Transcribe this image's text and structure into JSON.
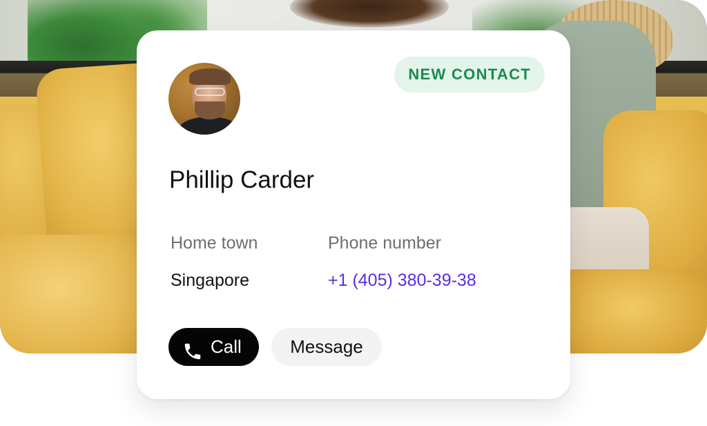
{
  "card": {
    "badge": "NEW CONTACT",
    "name": "Phillip Carder",
    "fields": [
      {
        "label": "Home town",
        "value": "Singapore"
      },
      {
        "label": "Phone number",
        "value": "+1 (405) 380-39-38"
      }
    ],
    "actions": {
      "call_label": "Call",
      "call_icon": "phone-icon",
      "message_label": "Message"
    }
  },
  "colors": {
    "badge_bg": "#e3f4ea",
    "badge_text": "#1b8a4f",
    "phone_link": "#5a2ee0",
    "call_button_bg": "#050505",
    "message_button_bg": "#f3f3f3"
  }
}
